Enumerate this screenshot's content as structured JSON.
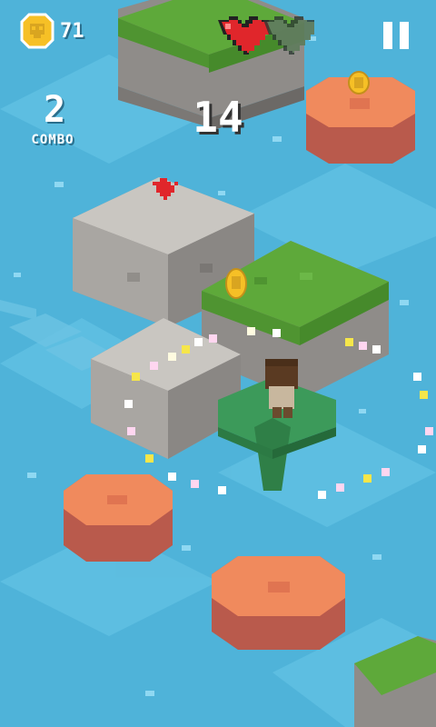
{
  "hud": {
    "coins": "71",
    "score": "14",
    "combo_count": "2",
    "combo_label": "COMBO",
    "lives_total": 2,
    "lives_remaining": 1
  },
  "icons": {
    "coin": "skull-coin-icon",
    "heart_full": "heart-full-icon",
    "heart_empty": "heart-empty-icon",
    "pause": "pause-icon"
  },
  "colors": {
    "water": "#4fb3d9",
    "grass_top": "#5ea93a",
    "stone_top": "#c9c6c1",
    "clay_top": "#f08a5d",
    "lily_top": "#3c9a5a",
    "heart_red": "#e0262b",
    "coin_gold": "#f6c026"
  }
}
